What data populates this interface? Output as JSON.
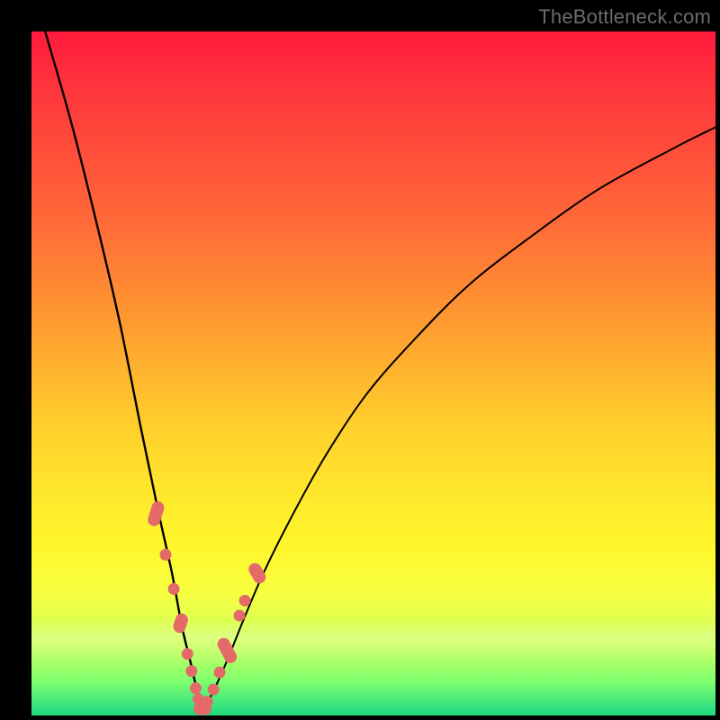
{
  "watermark": "TheBottleneck.com",
  "chart_data": {
    "type": "line",
    "title": "",
    "subtitle": "",
    "xlabel": "",
    "ylabel": "",
    "xlim": [
      0,
      100
    ],
    "ylim": [
      0,
      100
    ],
    "grid": false,
    "background": "vertical-gradient red→orange→yellow→green",
    "series": [
      {
        "name": "left-branch",
        "x": [
          2,
          6,
          10,
          13,
          16,
          18.5,
          20.5,
          22,
          23.2,
          24.0,
          24.6,
          25.0
        ],
        "values": [
          100,
          86,
          70,
          57,
          42,
          30,
          21,
          13,
          8,
          4.5,
          2.2,
          0.8
        ]
      },
      {
        "name": "right-branch",
        "x": [
          25.0,
          26.0,
          27.5,
          29,
          31,
          34,
          38,
          43,
          49,
          56,
          64,
          73,
          83,
          94,
          100
        ],
        "values": [
          0.8,
          2.4,
          5.5,
          9,
          14,
          21,
          29,
          38,
          47,
          55,
          63,
          70,
          77,
          83,
          86
        ]
      }
    ],
    "markers": {
      "name": "highlighted-points",
      "color": "#e46a6a",
      "points": [
        {
          "x": 18.2,
          "y": 29.5,
          "shape": "pill",
          "angle": -73,
          "len": 28
        },
        {
          "x": 19.6,
          "y": 23.5,
          "shape": "dot"
        },
        {
          "x": 20.8,
          "y": 18.5,
          "shape": "dot"
        },
        {
          "x": 21.8,
          "y": 13.5,
          "shape": "pill",
          "angle": -72,
          "len": 22
        },
        {
          "x": 22.8,
          "y": 9.0,
          "shape": "dot"
        },
        {
          "x": 23.4,
          "y": 6.5,
          "shape": "dot"
        },
        {
          "x": 24.0,
          "y": 4.0,
          "shape": "dot"
        },
        {
          "x": 24.4,
          "y": 2.4,
          "shape": "dot"
        },
        {
          "x": 25.0,
          "y": 1.0,
          "shape": "pill",
          "angle": 0,
          "len": 20
        },
        {
          "x": 25.7,
          "y": 2.0,
          "shape": "dot"
        },
        {
          "x": 26.6,
          "y": 3.8,
          "shape": "dot"
        },
        {
          "x": 27.5,
          "y": 6.3,
          "shape": "dot"
        },
        {
          "x": 28.6,
          "y": 9.5,
          "shape": "pill",
          "angle": 62,
          "len": 30
        },
        {
          "x": 30.4,
          "y": 14.6,
          "shape": "dot"
        },
        {
          "x": 31.2,
          "y": 16.8,
          "shape": "dot"
        },
        {
          "x": 33.0,
          "y": 20.8,
          "shape": "pill",
          "angle": 60,
          "len": 24
        }
      ]
    },
    "curve_minimum": {
      "x": 25,
      "y": 0.8
    },
    "legend": null,
    "annotations": []
  }
}
